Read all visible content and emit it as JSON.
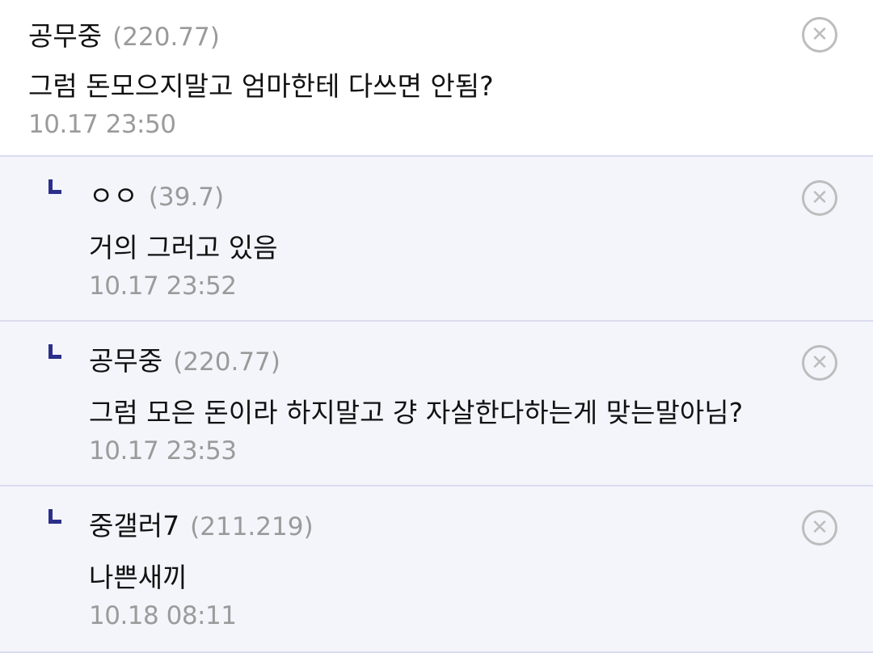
{
  "comments": [
    {
      "nick": "공무중",
      "ip": "(220.77)",
      "text": "그럼 돈모으지말고 엄마한테 다쓰면 안됨?",
      "date": "10.17 23:50",
      "delete_icon": "close-circle-icon"
    },
    {
      "nick": "ㅇㅇ",
      "ip": "(39.7)",
      "text": "거의 그러고 있음",
      "date": "10.17 23:52",
      "reply_icon": "reply-corner-icon",
      "delete_icon": "close-circle-icon"
    },
    {
      "nick": "공무중",
      "ip": "(220.77)",
      "text": "그럼 모은 돈이라 하지말고 걍 자살한다하는게 맞는말아님?",
      "date": "10.17 23:53",
      "reply_icon": "reply-corner-icon",
      "delete_icon": "close-circle-icon"
    },
    {
      "nick": "중갤러7",
      "ip": "(211.219)",
      "text": "나쁜새끼",
      "date": "10.18 08:11",
      "reply_icon": "reply-corner-icon",
      "delete_icon": "close-circle-icon"
    }
  ],
  "colors": {
    "reply_bg": "#f4f5fb",
    "divider": "#d9dcef",
    "reply_mark": "#2b2f8a",
    "meta_gray": "#9b9b9b"
  }
}
